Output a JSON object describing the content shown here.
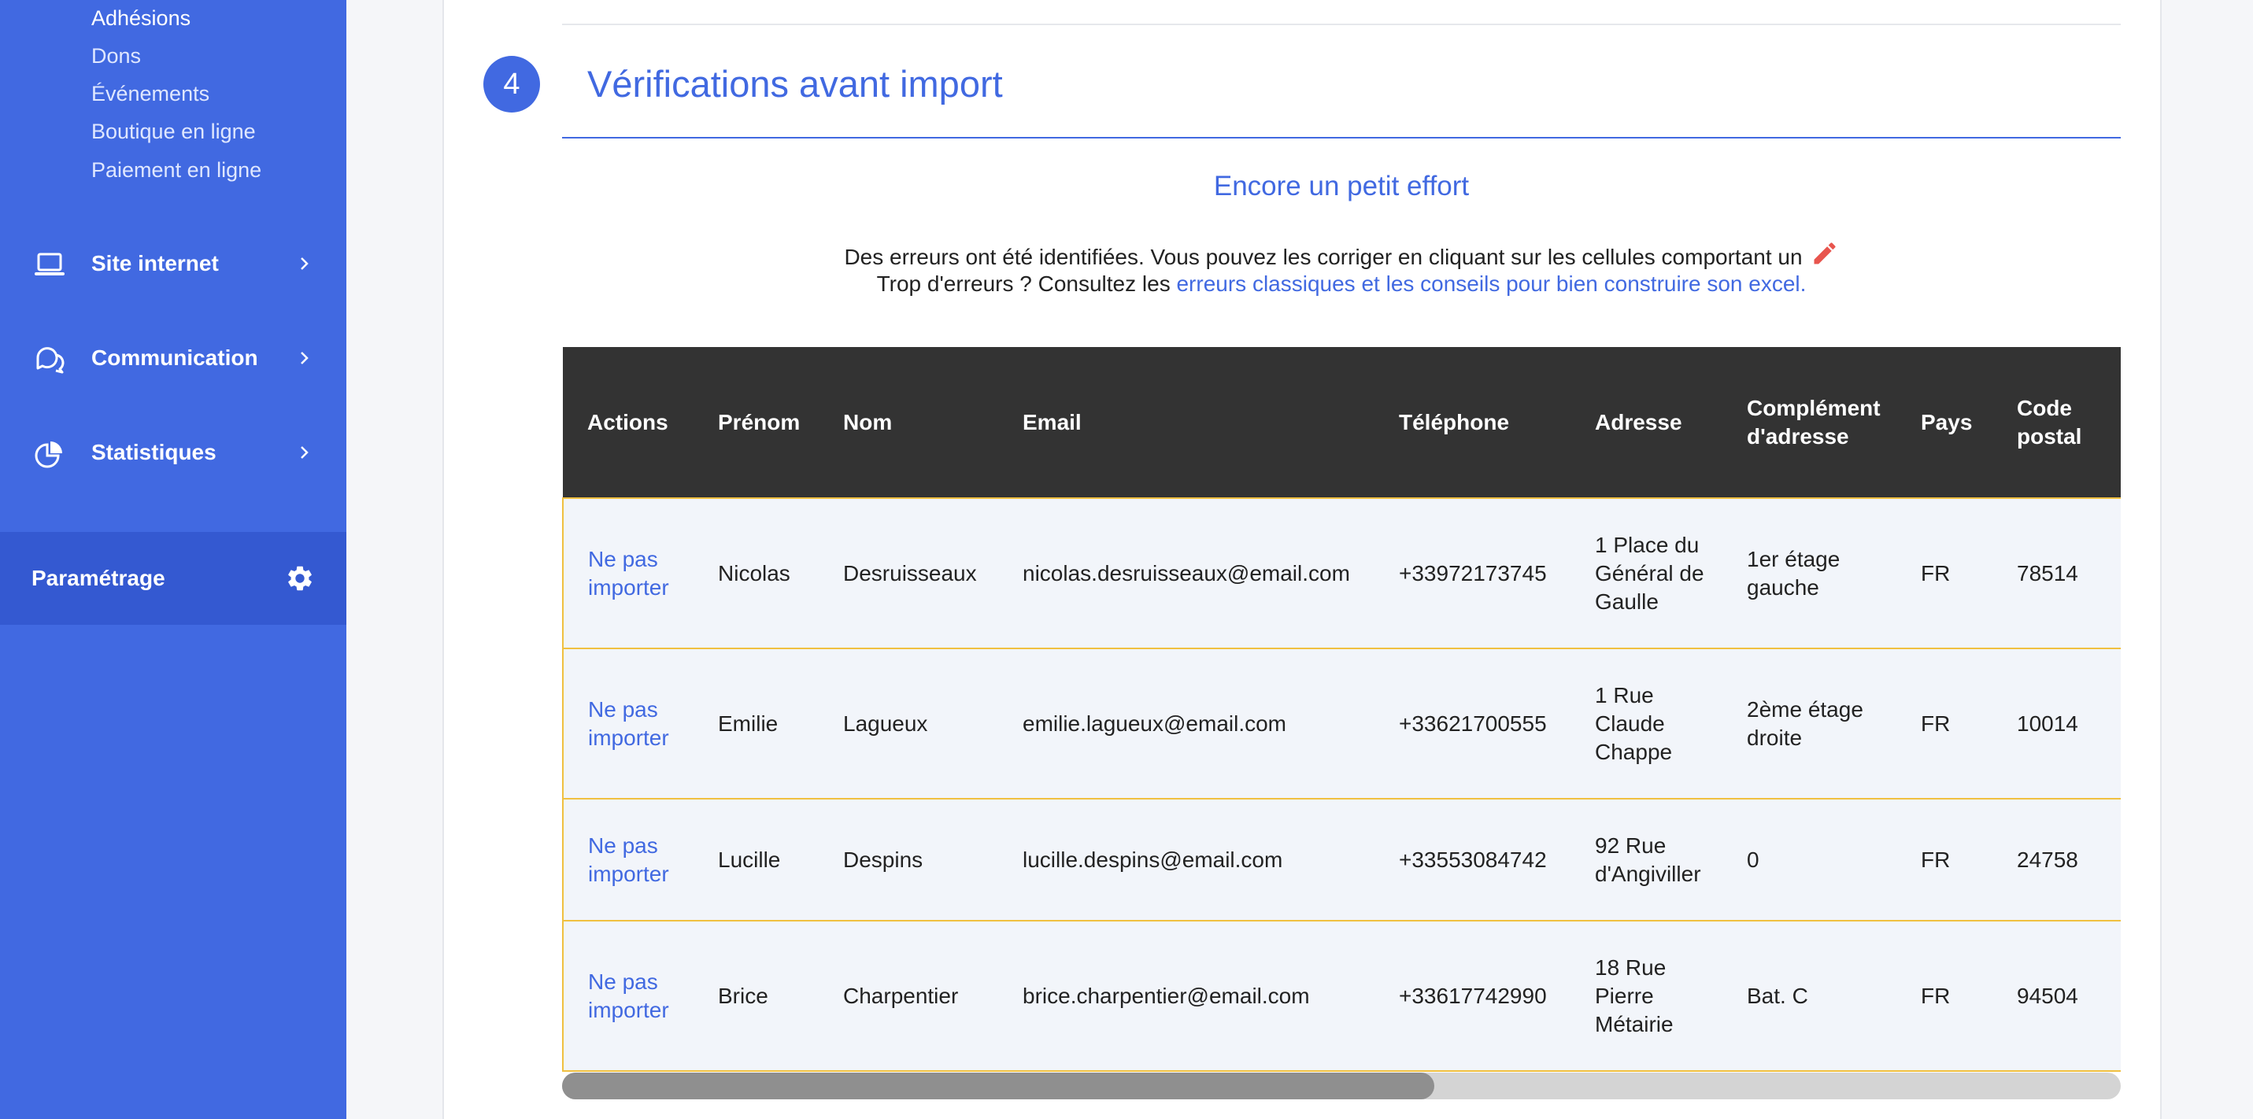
{
  "sidebar": {
    "sub_items": [
      "Adhésions",
      "Dons",
      "Événements",
      "Boutique en ligne",
      "Paiement en ligne"
    ],
    "nav_items": [
      {
        "label": "Site internet",
        "icon": "laptop-icon"
      },
      {
        "label": "Communication",
        "icon": "chat-bubbles-icon"
      },
      {
        "label": "Statistiques",
        "icon": "pie-chart-icon"
      }
    ],
    "settings": {
      "label": "Paramétrage",
      "icon": "gear-icon"
    }
  },
  "step": {
    "number": "4",
    "title": "Vérifications avant import"
  },
  "message": {
    "subtitle": "Encore un petit effort",
    "line1": "Des erreurs ont été identifiées. Vous pouvez les corriger en cliquant sur les cellules comportant un",
    "line2_prefix": "Trop d'erreurs ? Consultez les",
    "line2_link": "erreurs classiques et les conseils pour bien construire son excel."
  },
  "table": {
    "headers": [
      "Actions",
      "Prénom",
      "Nom",
      "Email",
      "Téléphone",
      "Adresse",
      "Complément d'adresse",
      "Pays",
      "Code postal"
    ],
    "rows": [
      {
        "action": "Ne pas importer",
        "prenom": "Nicolas",
        "nom": "Desruisseaux",
        "email": "nicolas.desruisseaux@email.com",
        "telephone": "+33972173745",
        "adresse": "1 Place du Général de Gaulle",
        "complement": "1er étage gauche",
        "pays": "FR",
        "code_postal": "78514"
      },
      {
        "action": "Ne pas importer",
        "prenom": "Emilie",
        "nom": "Lagueux",
        "email": "emilie.lagueux@email.com",
        "telephone": "+33621700555",
        "adresse": "1 Rue Claude Chappe",
        "complement": "2ème étage droite",
        "pays": "FR",
        "code_postal": "10014"
      },
      {
        "action": "Ne pas importer",
        "prenom": "Lucille",
        "nom": "Despins",
        "email": "lucille.despins@email.com",
        "telephone": "+33553084742",
        "adresse": "92 Rue d'Angiviller",
        "complement": "0",
        "pays": "FR",
        "code_postal": "24758"
      },
      {
        "action": "Ne pas importer",
        "prenom": "Brice",
        "nom": "Charpentier",
        "email": "brice.charpentier@email.com",
        "telephone": "+33617742990",
        "adresse": "18 Rue Pierre Métairie",
        "complement": "Bat. C",
        "pays": "FR",
        "code_postal": "94504"
      }
    ]
  },
  "colors": {
    "brand": "#4169e1",
    "error_border": "#f0c040",
    "pencil": "#e8554e",
    "table_header": "#333333"
  }
}
